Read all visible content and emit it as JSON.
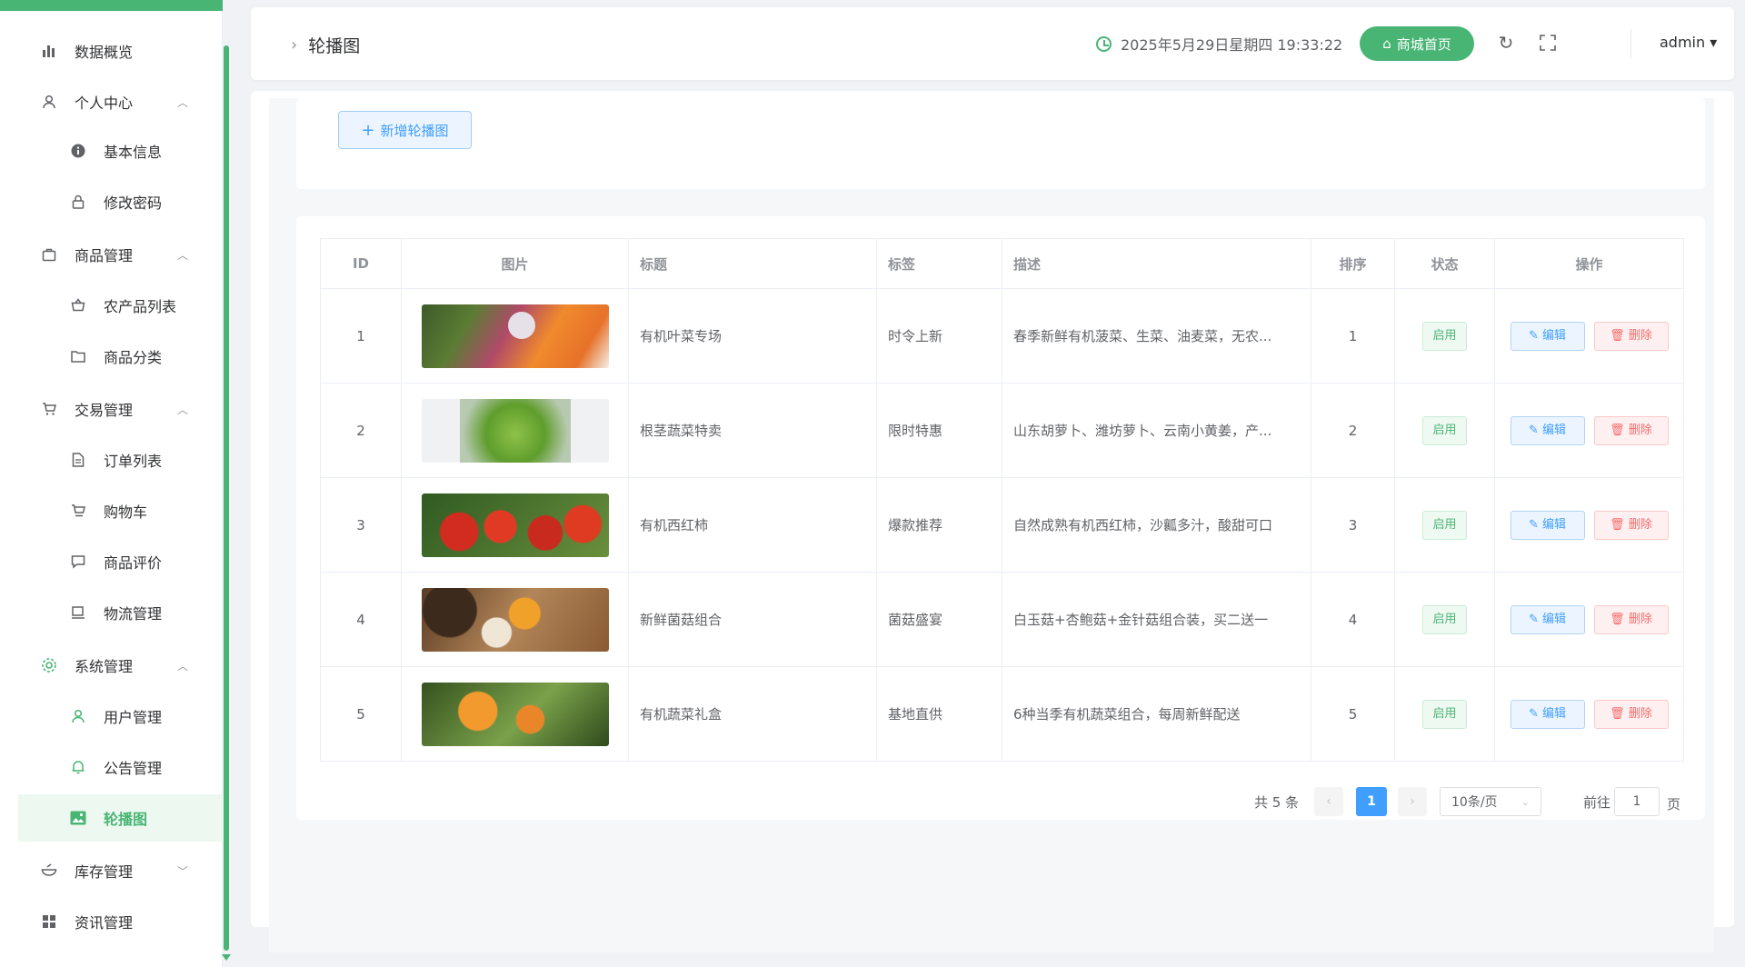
{
  "sidebar": {
    "items": [
      {
        "label": "数据概览",
        "icon": "bar-chart-icon"
      },
      {
        "label": "个人中心",
        "icon": "user-icon",
        "expanded": true
      },
      {
        "label": "基本信息",
        "icon": "info-icon"
      },
      {
        "label": "修改密码",
        "icon": "lock-icon"
      },
      {
        "label": "商品管理",
        "icon": "briefcase-icon",
        "expanded": true
      },
      {
        "label": "农产品列表",
        "icon": "basket-icon"
      },
      {
        "label": "商品分类",
        "icon": "folder-icon"
      },
      {
        "label": "交易管理",
        "icon": "cart-icon",
        "expanded": true
      },
      {
        "label": "订单列表",
        "icon": "document-icon"
      },
      {
        "label": "购物车",
        "icon": "cart-icon"
      },
      {
        "label": "商品评价",
        "icon": "comment-icon"
      },
      {
        "label": "物流管理",
        "icon": "truck-icon"
      },
      {
        "label": "系统管理",
        "icon": "gear-icon",
        "expanded": true
      },
      {
        "label": "用户管理",
        "icon": "user-icon"
      },
      {
        "label": "公告管理",
        "icon": "bell-icon"
      },
      {
        "label": "轮播图",
        "icon": "image-icon",
        "active": true
      },
      {
        "label": "库存管理",
        "icon": "bowl-icon",
        "expanded": false
      },
      {
        "label": "资讯管理",
        "icon": "grid-icon"
      }
    ]
  },
  "header": {
    "breadcrumb": "轮播图",
    "datetime": "2025年5月29日星期四 19:33:22",
    "home_button": "商城首页",
    "user": "admin ▾"
  },
  "toolbar": {
    "add_button": "新增轮播图"
  },
  "table": {
    "columns": [
      "ID",
      "图片",
      "标题",
      "标签",
      "描述",
      "排序",
      "状态",
      "操作"
    ],
    "rows": [
      {
        "id": "1",
        "image": "veg",
        "title": "有机叶菜专场",
        "tag": "时令上新",
        "desc": "春季新鲜有机菠菜、生菜、油麦菜，无农...",
        "sort": "1",
        "status": "启用"
      },
      {
        "id": "2",
        "image": "lettuce",
        "title": "根茎蔬菜特卖",
        "tag": "限时特惠",
        "desc": "山东胡萝卜、潍坊萝卜、云南小黄姜，产...",
        "sort": "2",
        "status": "启用"
      },
      {
        "id": "3",
        "image": "tomato",
        "title": "有机西红柿",
        "tag": "爆款推荐",
        "desc": "自然成熟有机西红柿，沙瓤多汁，酸甜可口",
        "sort": "3",
        "status": "启用"
      },
      {
        "id": "4",
        "image": "mushroom",
        "title": "新鲜菌菇组合",
        "tag": "菌菇盛宴",
        "desc": "白玉菇+杏鲍菇+金针菇组合装，买二送一",
        "sort": "4",
        "status": "启用"
      },
      {
        "id": "5",
        "image": "orange",
        "title": "有机蔬菜礼盒",
        "tag": "基地直供",
        "desc": "6种当季有机蔬菜组合，每周新鲜配送",
        "sort": "5",
        "status": "启用"
      }
    ],
    "edit_label": "编辑",
    "delete_label": "删除"
  },
  "pagination": {
    "total": "共 5 条",
    "current": "1",
    "page_size": "10条/页",
    "goto_prefix": "前往",
    "goto_value": "1",
    "goto_suffix": "页"
  },
  "colors": {
    "primary": "#49b574",
    "link": "#409eff",
    "danger": "#f56c6c"
  }
}
